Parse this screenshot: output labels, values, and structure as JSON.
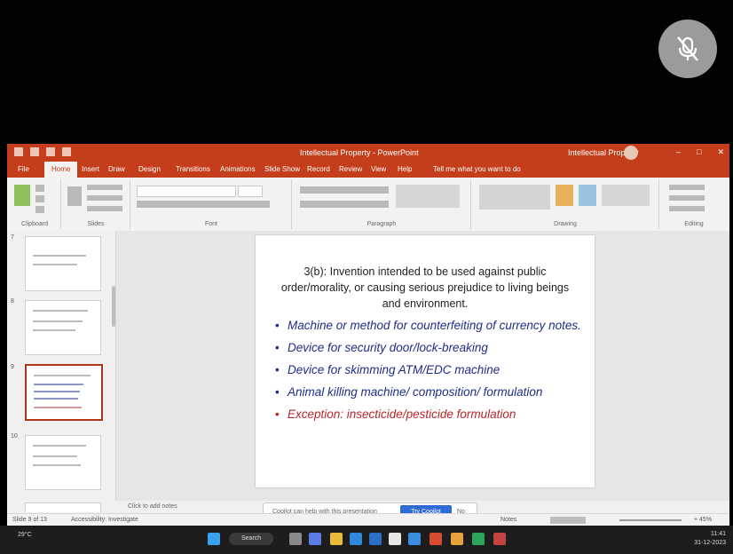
{
  "mute_icon": "microphone-off-icon",
  "window": {
    "title": "Intellectual Property - PowerPoint",
    "user": "Intellectual Property",
    "minimize": "–",
    "maximize": "□",
    "close": "✕"
  },
  "ribbon_tabs": [
    "File",
    "Home",
    "Insert",
    "Draw",
    "Design",
    "Transitions",
    "Animations",
    "Slide Show",
    "Record",
    "Review",
    "View",
    "Help",
    "Tell me what you want to do"
  ],
  "ribbon_groups": [
    "Clipboard",
    "Slides",
    "Font",
    "Paragraph",
    "Drawing",
    "Editing"
  ],
  "slide": {
    "intro": "3(b): Invention intended to be used against public order/morality, or causing serious prejudice to living beings and environment.",
    "bullets": [
      "Machine or method for counterfeiting of currency notes.",
      "Device for security door/lock-breaking",
      "Device for skimming ATM/EDC machine",
      "Animal killing machine/ composition/ formulation"
    ],
    "exception": "Exception: insecticide/pesticide formulation",
    "bullet_color": "#1f2d86",
    "exception_color": "#b8262b"
  },
  "thumbnails": [
    "7",
    "8",
    "9",
    "10"
  ],
  "notes_placeholder": "Click to add notes",
  "copilot_bar": {
    "message": "Copilot can help with this presentation",
    "primary": "Try Copilot",
    "secondary": "No"
  },
  "statusbar": {
    "slide_counter": "Slide 9 of 13",
    "accessibility": "Accessibility: Investigate",
    "notes": "Notes",
    "zoom": "+ 45%"
  },
  "taskbar": {
    "weather": "29°C",
    "search": "Search",
    "time": "11:41",
    "date": "31-12-2023"
  },
  "colors": {
    "accent": "#c43e1c",
    "selection": "#b0361b"
  }
}
